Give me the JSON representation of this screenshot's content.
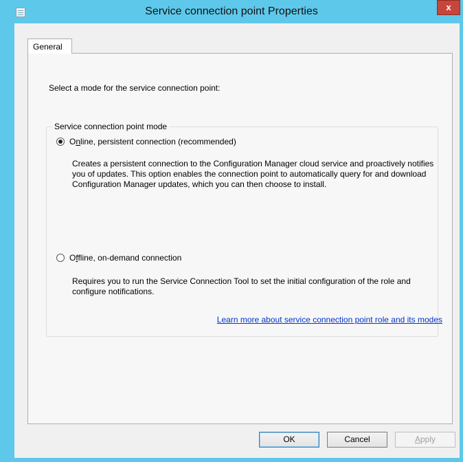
{
  "window": {
    "title": "Service connection point Properties",
    "close_label": "x"
  },
  "tabs": [
    {
      "label": "General",
      "selected": true
    }
  ],
  "general": {
    "prompt": "Select a mode for the service connection point:",
    "group_title": "Service connection point mode",
    "options": [
      {
        "label_pre": "O",
        "label_accel": "n",
        "label_post": "line, persistent connection (recommended)",
        "checked": true,
        "description": "Creates a persistent connection to the Configuration Manager cloud service and proactively notifies you of updates. This option enables the connection point to automatically query for and download Configuration Manager updates, which you can then choose to install."
      },
      {
        "label_pre": "O",
        "label_accel": "f",
        "label_post": "fline, on-demand connection",
        "checked": false,
        "description": "Requires you to run the Service Connection Tool to set the initial configuration of the role and configure notifications."
      }
    ],
    "learn_more_link": "Learn more about service connection point role and its modes"
  },
  "buttons": {
    "ok": "OK",
    "cancel": "Cancel",
    "apply_pre": "",
    "apply_accel": "A",
    "apply_post": "pply",
    "apply_enabled": false
  },
  "colors": {
    "titlebar": "#5ec8ea",
    "close": "#c7463b",
    "link": "#0033cc",
    "dialog_bg": "#f0f0f0"
  }
}
